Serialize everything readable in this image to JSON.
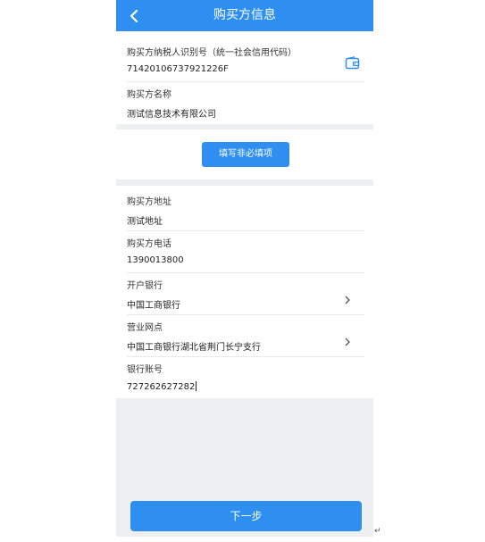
{
  "header": {
    "title": "购买方信息"
  },
  "buyer": {
    "tax_id_label": "购买方纳税人识别号（统一社会信用代码）",
    "tax_id_value": "71420106737921226F",
    "name_label": "购买方名称",
    "name_value": "测试信息技术有限公司"
  },
  "optional_button_label": "填写非必填项",
  "optional_fields": {
    "address_label": "购买方地址",
    "address_value": "测试地址",
    "phone_label": "购买方电话",
    "phone_value": "1390013800",
    "bank_label": "开户银行",
    "bank_value": "中国工商银行",
    "branch_label": "营业网点",
    "branch_value": "中国工商银行湖北省荆门长宁支行",
    "account_label": "银行账号",
    "account_value": "727262627282"
  },
  "next_button_label": "下一步",
  "return_mark": "↵",
  "colors": {
    "primary": "#2f8ff0",
    "background": "#eeeff1"
  },
  "icons": {
    "back": "back-arrow-icon",
    "wallet": "wallet-icon",
    "chevron": "chevron-right-icon"
  }
}
